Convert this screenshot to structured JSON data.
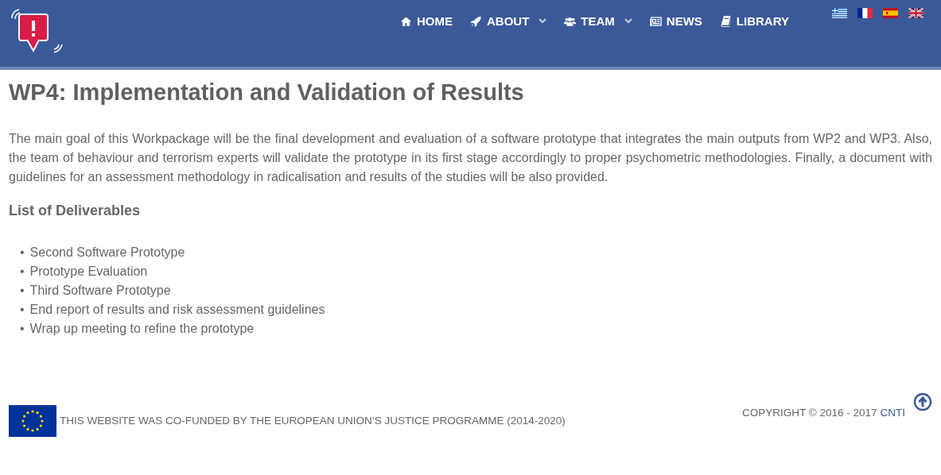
{
  "nav": {
    "items": [
      {
        "label": "HOME",
        "kind": "home",
        "dropdown": false
      },
      {
        "label": "ABOUT",
        "kind": "rocket",
        "dropdown": true
      },
      {
        "label": "TEAM",
        "kind": "users",
        "dropdown": true
      },
      {
        "label": "NEWS",
        "kind": "newspaper",
        "dropdown": false
      },
      {
        "label": "LIBRARY",
        "kind": "book",
        "dropdown": false
      }
    ],
    "languages": [
      {
        "kind": "gr"
      },
      {
        "kind": "fr"
      },
      {
        "kind": "es"
      },
      {
        "kind": "gb"
      }
    ]
  },
  "page": {
    "title": "WP4: Implementation and Validation of Results",
    "intro": "The main goal of this Workpackage will be the final development and evaluation of a software prototype that integrates the main outputs from WP2 and WP3. Also, the team of behaviour and terrorism experts will validate the prototype in its first stage accordingly to proper psychometric methodologies. Finally, a document with guidelines for an assessment methodology in radicalisation and results of the studies will be also provided.",
    "deliverables_heading": "List of Deliverables",
    "deliverables": [
      {
        "marker": "•",
        "text": "Second Software Prototype"
      },
      {
        "marker": "•",
        "text": "Prototype Evaluation"
      },
      {
        "marker": "•",
        "text": "Third Software Prototype"
      },
      {
        "marker": "•",
        "text": "End report of results and risk assessment guidelines"
      },
      {
        "marker": "•",
        "text": "Wrap up meeting to refine the prototype"
      }
    ]
  },
  "footer": {
    "funding": "THIS WEBSITE WAS CO-FUNDED BY THE EUROPEAN UNION’S JUSTICE PROGRAMME (2014-2020)",
    "copyright": "COPYRIGHT © 2016 - 2017",
    "copyright_link": "CNTI"
  }
}
